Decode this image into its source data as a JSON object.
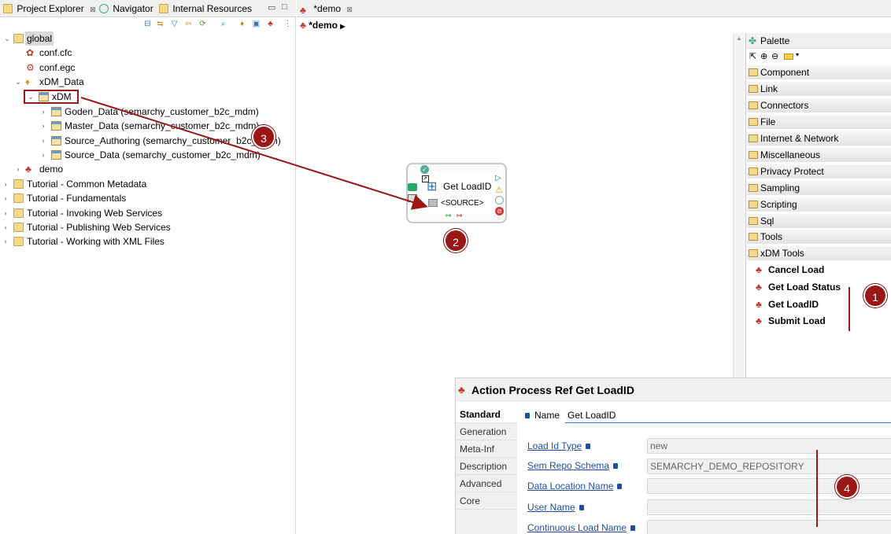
{
  "left_tabs": [
    {
      "label": "Project Explorer",
      "close": "⊠"
    },
    {
      "label": "Navigator"
    },
    {
      "label": "Internal Resources"
    }
  ],
  "win_buttons": {
    "minimize": "▭",
    "maximize": "□"
  },
  "tree": {
    "global": "global",
    "conf_cfc": "conf.cfc",
    "conf_egc": "conf.egc",
    "xdm_data": "xDM_Data",
    "xdm": "xDM",
    "children": [
      "Goden_Data (semarchy_customer_b2c_mdm)",
      "Master_Data (semarchy_customer_b2c_mdm)",
      "Source_Authoring (semarchy_customer_b2c_mdm)",
      "Source_Data (semarchy_customer_b2c_mdm)"
    ],
    "demo": "demo",
    "tutorials": [
      "Tutorial - Common Metadata",
      "Tutorial - Fundamentals",
      "Tutorial - Invoking Web Services",
      "Tutorial - Publishing Web Services",
      "Tutorial - Working with XML Files"
    ]
  },
  "editor": {
    "tab_label": "*demo",
    "tab_close": "⊠",
    "breadcrumb": "*demo"
  },
  "node": {
    "title": "Get LoadID",
    "source": "<SOURCE>"
  },
  "palette": {
    "header": "Palette",
    "drawers": [
      "Component",
      "Link",
      "Connectors",
      "File",
      "Internet & Network",
      "Miscellaneous",
      "Privacy Protect",
      "Sampling",
      "Scripting",
      "Sql",
      "Tools",
      "xDM Tools"
    ],
    "items": [
      "Cancel Load",
      "Get Load Status",
      "Get LoadID",
      "Submit Load"
    ]
  },
  "properties": {
    "title": "Action Process Ref Get LoadID",
    "tabs": [
      "Standard",
      "Generation",
      "Meta-Inf",
      "Description",
      "Advanced",
      "Core"
    ],
    "name_label": "Name",
    "name_value": "Get LoadID",
    "fields": [
      {
        "label": "Load Id Type",
        "value": "new"
      },
      {
        "label": "Sem Repo Schema",
        "value": "SEMARCHY_DEMO_REPOSITORY"
      },
      {
        "label": "Data Location Name",
        "value": ""
      },
      {
        "label": "User Name",
        "value": ""
      },
      {
        "label": "Continuous Load Name",
        "value": ""
      }
    ]
  },
  "badges": [
    "1",
    "2",
    "3",
    "4"
  ],
  "colors": {
    "annotation": "#9a1716",
    "link": "#1f4fa0",
    "folder": "#f4d98b"
  }
}
